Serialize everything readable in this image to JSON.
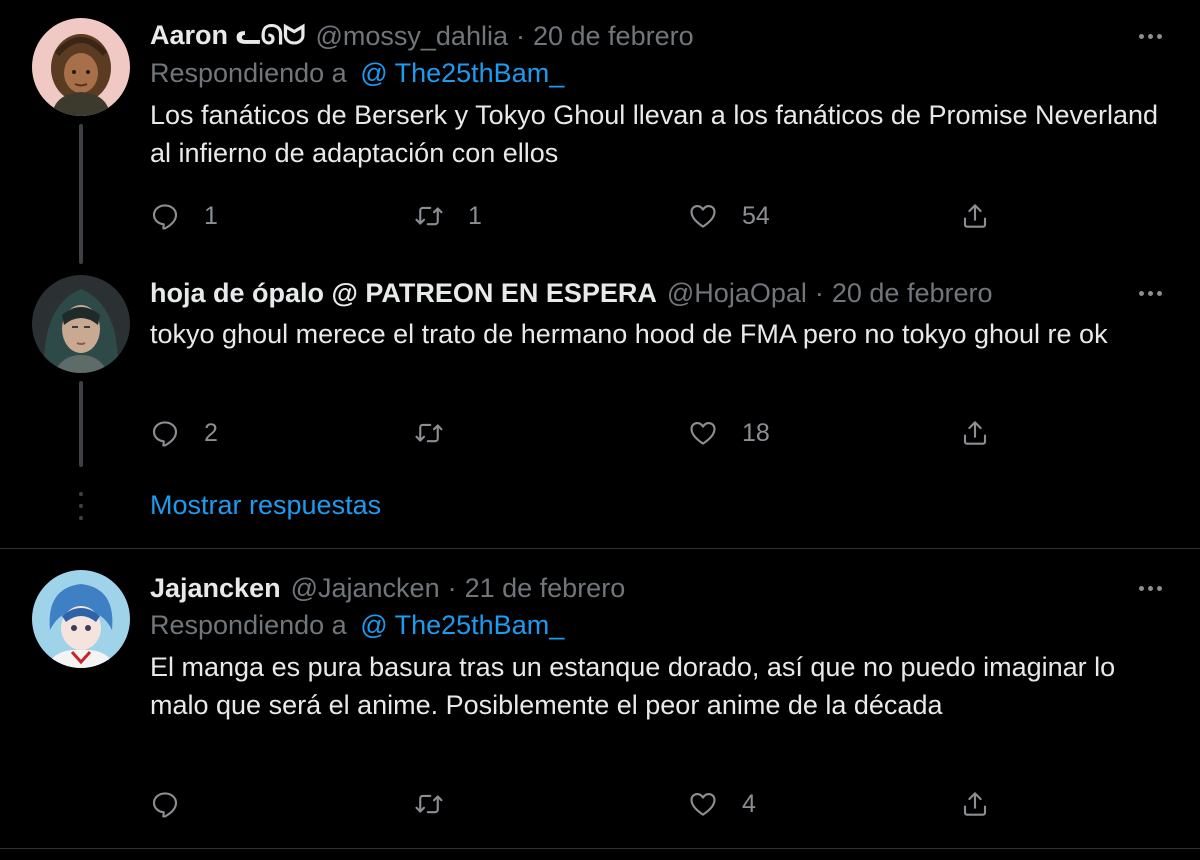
{
  "tweets": [
    {
      "name": "Aaron ᓚᘏᗢ",
      "handle": "@mossy_dahlia",
      "separator": "·",
      "date": "20 de febrero",
      "replying_prefix": "Respondiendo a",
      "replying_mention": "@ The25thBam_",
      "text": "Los fanáticos de Berserk y Tokyo Ghoul llevan a los fanáticos de Promise Neverland al infierno de adaptación con ellos",
      "replies": "1",
      "retweets": "1",
      "likes": "54"
    },
    {
      "name": "hoja de ópalo @ PATREON EN ESPERA",
      "handle": "@HojaOpal",
      "separator": "·",
      "date": "20 de febrero",
      "text": "tokyo ghoul merece el trato de hermano hood de FMA pero no tokyo ghoul re ok",
      "replies": "2",
      "retweets": "",
      "likes": "18"
    },
    {
      "name": "Jajancken",
      "handle": "@Jajancken",
      "separator": "·",
      "date": "21 de febrero",
      "replying_prefix": "Respondiendo a",
      "replying_mention": "@ The25thBam_",
      "text": "El manga es pura basura tras un estanque dorado, así que no puedo imaginar lo malo que será el anime. Posiblemente el peor anime de la década",
      "replies": "",
      "retweets": "",
      "likes": "4"
    }
  ],
  "show_replies_label": "Mostrar respuestas",
  "icons": {
    "reply": "reply-icon",
    "retweet": "retweet-icon",
    "like": "heart-icon",
    "share": "share-icon",
    "more": "more-icon"
  },
  "colors": {
    "background": "#000000",
    "text": "#e7e9ea",
    "secondary": "#71767b",
    "accent": "#1d9bf0",
    "divider": "#2f3336"
  }
}
